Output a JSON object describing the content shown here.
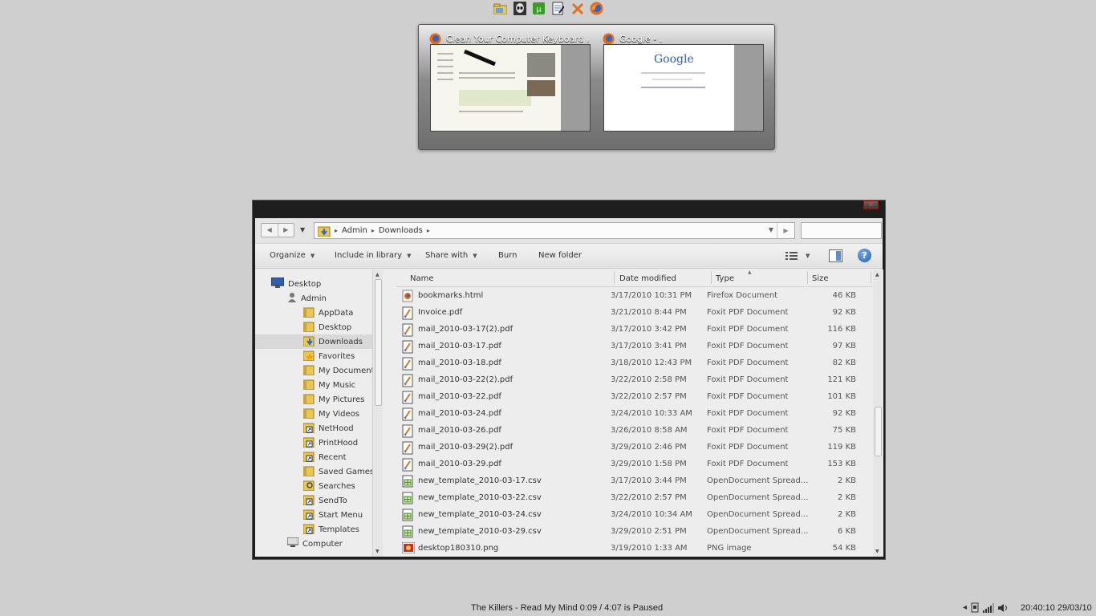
{
  "dock": {
    "icons": [
      "explorer-folder-icon",
      "alien-app-icon",
      "torrent-app-icon",
      "notepad-app-icon",
      "tools-app-icon",
      "firefox-icon"
    ]
  },
  "taskbar_preview": {
    "items": [
      {
        "title": "Clean Your Computer Keyboard ...",
        "icon": "firefox-icon"
      },
      {
        "title": "Google - .",
        "icon": "firefox-icon",
        "logo_text": "Google"
      }
    ]
  },
  "explorer": {
    "close_label": "x",
    "breadcrumb": [
      "Admin",
      "Downloads"
    ],
    "search_placeholder": "",
    "toolbar": {
      "organize": "Organize",
      "include_in_library": "Include in library",
      "share_with": "Share with",
      "burn": "Burn",
      "new_folder": "New folder"
    },
    "tree": [
      {
        "label": "Desktop",
        "icon": "desktop-icon",
        "indent": 0
      },
      {
        "label": "Admin",
        "icon": "user-icon",
        "indent": 1
      },
      {
        "label": "AppData",
        "icon": "folder-icon",
        "indent": 2
      },
      {
        "label": "Desktop",
        "icon": "folder-icon",
        "indent": 2
      },
      {
        "label": "Downloads",
        "icon": "downloads-folder-icon",
        "indent": 2,
        "selected": true
      },
      {
        "label": "Favorites",
        "icon": "favorites-folder-icon",
        "indent": 2
      },
      {
        "label": "My Documents",
        "icon": "folder-icon",
        "indent": 2
      },
      {
        "label": "My Music",
        "icon": "folder-icon",
        "indent": 2
      },
      {
        "label": "My Pictures",
        "icon": "folder-icon",
        "indent": 2
      },
      {
        "label": "My Videos",
        "icon": "folder-icon",
        "indent": 2
      },
      {
        "label": "NetHood",
        "icon": "shortcut-icon",
        "indent": 2
      },
      {
        "label": "PrintHood",
        "icon": "shortcut-icon",
        "indent": 2
      },
      {
        "label": "Recent",
        "icon": "shortcut-icon",
        "indent": 2
      },
      {
        "label": "Saved Games",
        "icon": "folder-icon",
        "indent": 2
      },
      {
        "label": "Searches",
        "icon": "search-folder-icon",
        "indent": 2
      },
      {
        "label": "SendTo",
        "icon": "shortcut-icon",
        "indent": 2
      },
      {
        "label": "Start Menu",
        "icon": "shortcut-icon",
        "indent": 2
      },
      {
        "label": "Templates",
        "icon": "shortcut-icon",
        "indent": 2
      },
      {
        "label": "Computer",
        "icon": "computer-icon",
        "indent": 1
      }
    ],
    "columns": {
      "name": "Name",
      "date": "Date modified",
      "type": "Type",
      "size": "Size"
    },
    "files": [
      {
        "name": "bookmarks.html",
        "date": "3/17/2010 10:31 PM",
        "type": "Firefox Document",
        "size": "46 KB",
        "icon": "firefox-doc-icon"
      },
      {
        "name": "Invoice.pdf",
        "date": "3/21/2010 8:44 PM",
        "type": "Foxit PDF Document",
        "size": "92 KB",
        "icon": "pdf-icon"
      },
      {
        "name": "mail_2010-03-17(2).pdf",
        "date": "3/17/2010 3:42 PM",
        "type": "Foxit PDF Document",
        "size": "116 KB",
        "icon": "pdf-icon"
      },
      {
        "name": "mail_2010-03-17.pdf",
        "date": "3/17/2010 3:41 PM",
        "type": "Foxit PDF Document",
        "size": "97 KB",
        "icon": "pdf-icon"
      },
      {
        "name": "mail_2010-03-18.pdf",
        "date": "3/18/2010 12:43 PM",
        "type": "Foxit PDF Document",
        "size": "82 KB",
        "icon": "pdf-icon"
      },
      {
        "name": "mail_2010-03-22(2).pdf",
        "date": "3/22/2010 2:58 PM",
        "type": "Foxit PDF Document",
        "size": "121 KB",
        "icon": "pdf-icon"
      },
      {
        "name": "mail_2010-03-22.pdf",
        "date": "3/22/2010 2:57 PM",
        "type": "Foxit PDF Document",
        "size": "101 KB",
        "icon": "pdf-icon"
      },
      {
        "name": "mail_2010-03-24.pdf",
        "date": "3/24/2010 10:33 AM",
        "type": "Foxit PDF Document",
        "size": "92 KB",
        "icon": "pdf-icon"
      },
      {
        "name": "mail_2010-03-26.pdf",
        "date": "3/26/2010 8:58 AM",
        "type": "Foxit PDF Document",
        "size": "75 KB",
        "icon": "pdf-icon"
      },
      {
        "name": "mail_2010-03-29(2).pdf",
        "date": "3/29/2010 2:46 PM",
        "type": "Foxit PDF Document",
        "size": "119 KB",
        "icon": "pdf-icon"
      },
      {
        "name": "mail_2010-03-29.pdf",
        "date": "3/29/2010 1:58 PM",
        "type": "Foxit PDF Document",
        "size": "153 KB",
        "icon": "pdf-icon"
      },
      {
        "name": "new_template_2010-03-17.csv",
        "date": "3/17/2010 3:44 PM",
        "type": "OpenDocument Spread...",
        "size": "2 KB",
        "icon": "spreadsheet-icon"
      },
      {
        "name": "new_template_2010-03-22.csv",
        "date": "3/22/2010 2:57 PM",
        "type": "OpenDocument Spread...",
        "size": "2 KB",
        "icon": "spreadsheet-icon"
      },
      {
        "name": "new_template_2010-03-24.csv",
        "date": "3/24/2010 10:34 AM",
        "type": "OpenDocument Spread...",
        "size": "2 KB",
        "icon": "spreadsheet-icon"
      },
      {
        "name": "new_template_2010-03-29.csv",
        "date": "3/29/2010 2:51 PM",
        "type": "OpenDocument Spread...",
        "size": "6 KB",
        "icon": "spreadsheet-icon"
      },
      {
        "name": "desktop180310.png",
        "date": "3/19/2010 1:33 AM",
        "type": "PNG image",
        "size": "54 KB",
        "icon": "image-icon"
      }
    ]
  },
  "now_playing": "The Killers - Read My Mind  0:09 / 4:07  is Paused",
  "tray": {
    "icons": [
      "volume-arrow-icon",
      "network-plug-icon",
      "signal-icon",
      "speaker-icon"
    ]
  },
  "clock": "20:40:10 29/03/10",
  "colors": {
    "desktop_bg": "#cfcfcf",
    "window_frame": "#1e1e1e",
    "window_body": "#ededed"
  }
}
